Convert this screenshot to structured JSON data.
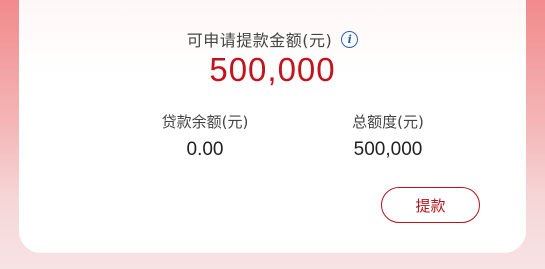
{
  "summary": {
    "available_label": "可申请提款金额(元)",
    "available_amount": "500,000",
    "loan_balance_label": "贷款余额(元)",
    "loan_balance_value": "0.00",
    "total_limit_label": "总额度(元)",
    "total_limit_value": "500,000",
    "info_icon": "info-icon",
    "withdraw_button_label": "提款"
  },
  "colors": {
    "accent": "#c3141c",
    "info_icon": "#2b62b5",
    "background_top": "#f28a8c"
  }
}
